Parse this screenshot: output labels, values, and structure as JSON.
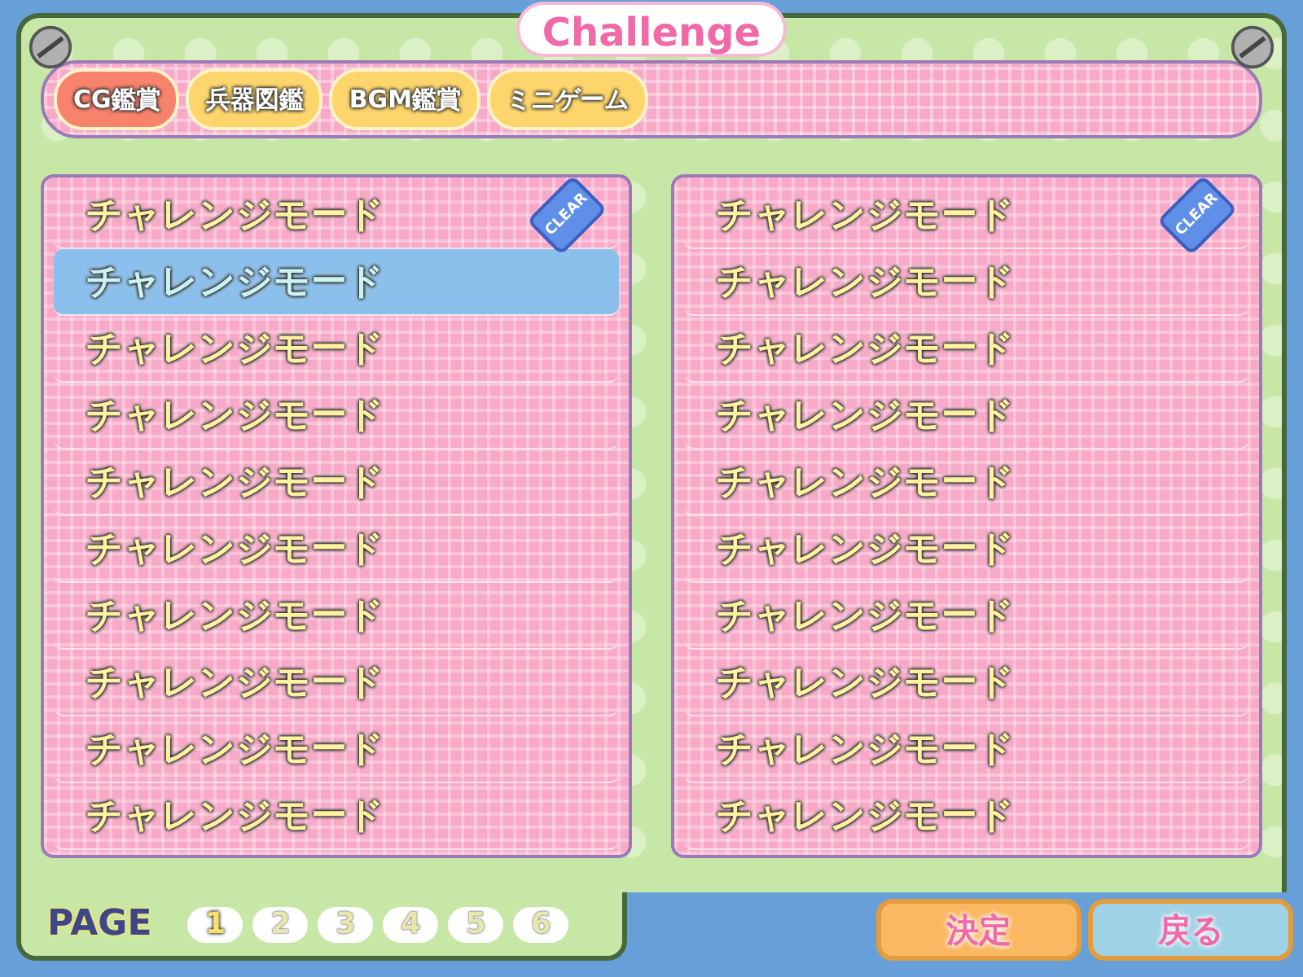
{
  "title": "Challenge",
  "tabs": [
    {
      "label": "CG鑑賞",
      "selected": true
    },
    {
      "label": "兵器図鑑",
      "selected": false
    },
    {
      "label": "BGM鑑賞",
      "selected": false
    },
    {
      "label": "ミニゲーム",
      "selected": false
    }
  ],
  "lists": [
    {
      "rows": [
        {
          "label": "チャレンジモード",
          "selected": false,
          "clear": "CLEAR"
        },
        {
          "label": "チャレンジモード",
          "selected": true
        },
        {
          "label": "チャレンジモード",
          "selected": false
        },
        {
          "label": "チャレンジモード",
          "selected": false
        },
        {
          "label": "チャレンジモード",
          "selected": false
        },
        {
          "label": "チャレンジモード",
          "selected": false
        },
        {
          "label": "チャレンジモード",
          "selected": false
        },
        {
          "label": "チャレンジモード",
          "selected": false
        },
        {
          "label": "チャレンジモード",
          "selected": false
        },
        {
          "label": "チャレンジモード",
          "selected": false
        }
      ]
    },
    {
      "rows": [
        {
          "label": "チャレンジモード",
          "selected": false,
          "clear": "CLEAR"
        },
        {
          "label": "チャレンジモード",
          "selected": false
        },
        {
          "label": "チャレンジモード",
          "selected": false
        },
        {
          "label": "チャレンジモード",
          "selected": false
        },
        {
          "label": "チャレンジモード",
          "selected": false
        },
        {
          "label": "チャレンジモード",
          "selected": false
        },
        {
          "label": "チャレンジモード",
          "selected": false
        },
        {
          "label": "チャレンジモード",
          "selected": false
        },
        {
          "label": "チャレンジモード",
          "selected": false
        },
        {
          "label": "チャレンジモード",
          "selected": false
        }
      ]
    }
  ],
  "pager": {
    "label": "PAGE",
    "pages": [
      {
        "label": "1",
        "selected": true
      },
      {
        "label": "2",
        "selected": false
      },
      {
        "label": "3",
        "selected": false
      },
      {
        "label": "4",
        "selected": false
      },
      {
        "label": "5",
        "selected": false
      },
      {
        "label": "6",
        "selected": false
      }
    ]
  },
  "buttons": [
    {
      "label": "決定",
      "kind": "confirm"
    },
    {
      "label": "戻る",
      "kind": "back"
    }
  ]
}
